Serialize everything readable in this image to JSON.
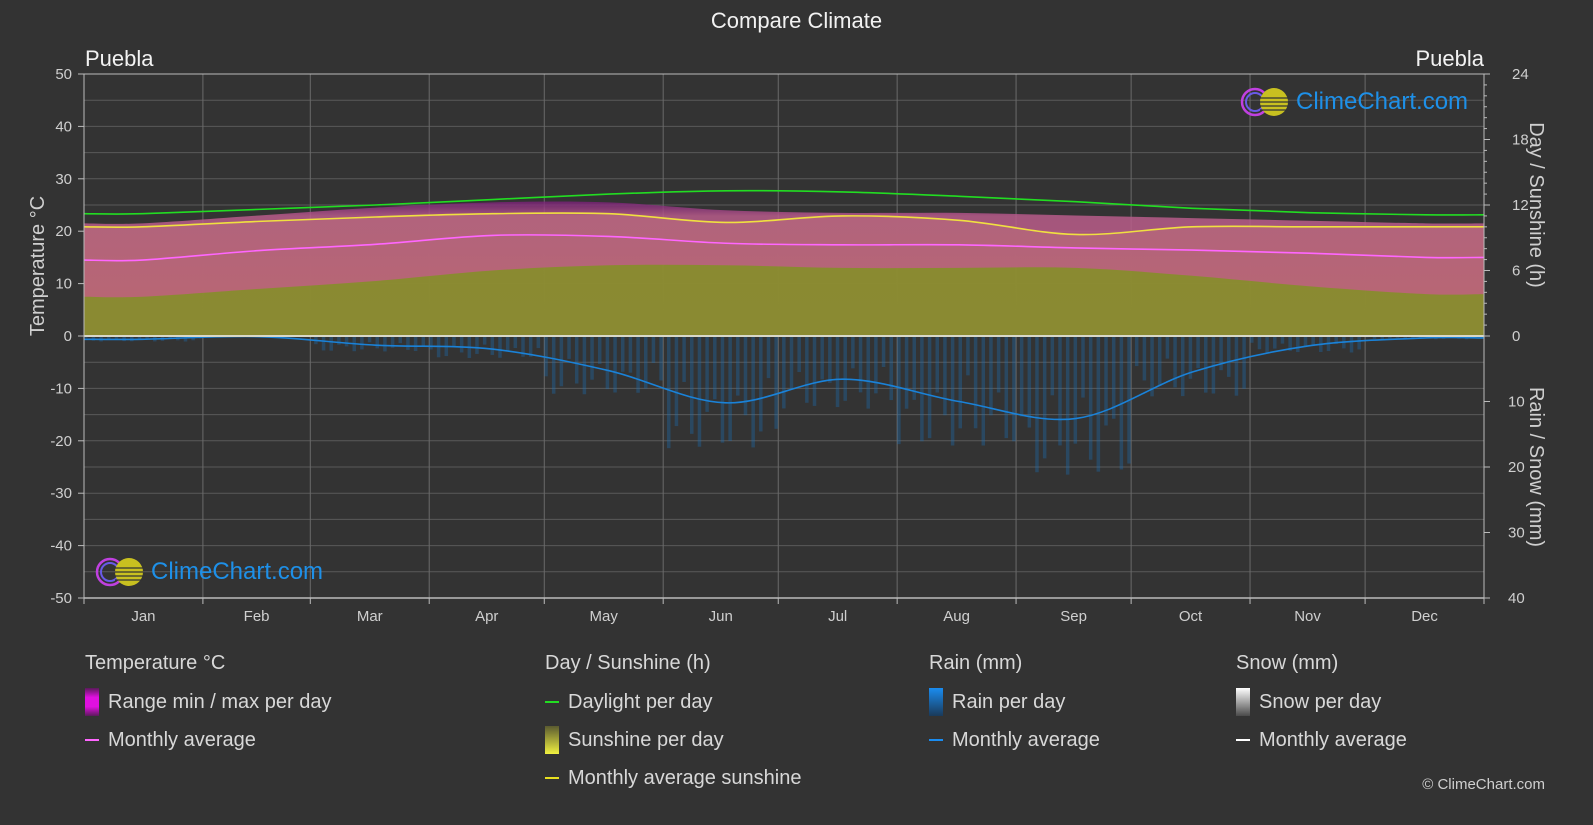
{
  "title": "Compare Climate",
  "city_left": "Puebla",
  "city_right": "Puebla",
  "logo_text": "ClimeChart.com",
  "copyright": "© ClimeChart.com",
  "colors": {
    "background": "#333333",
    "temp_range": "#e13ce1",
    "temp_avg": "#ff66ff",
    "daylight": "#22dd22",
    "sunshine_fill": "#8f8f30",
    "sunshine_avg": "#f0e040",
    "rain": "#1a82d8",
    "snow": "#ffffff",
    "grid": "#5a5a5a"
  },
  "legend": {
    "temperature": {
      "head": "Temperature °C",
      "items": [
        "Range min / max per day",
        "Monthly average"
      ]
    },
    "sunshine": {
      "head": "Day / Sunshine (h)",
      "items": [
        "Daylight per day",
        "Sunshine per day",
        "Monthly average sunshine"
      ]
    },
    "rain": {
      "head": "Rain (mm)",
      "items": [
        "Rain per day",
        "Monthly average"
      ]
    },
    "snow": {
      "head": "Snow (mm)",
      "items": [
        "Snow per day",
        "Monthly average"
      ]
    }
  },
  "chart_data": {
    "type": "line",
    "title": "Compare Climate",
    "categories": [
      "Jan",
      "Feb",
      "Mar",
      "Apr",
      "May",
      "Jun",
      "Jul",
      "Aug",
      "Sep",
      "Oct",
      "Nov",
      "Dec"
    ],
    "left_axis": {
      "label": "Temperature °C",
      "range": [
        -50,
        50
      ],
      "ticks": [
        50,
        40,
        30,
        20,
        10,
        0,
        -10,
        -20,
        -30,
        -40,
        -50
      ]
    },
    "right_axis_top": {
      "label": "Day / Sunshine (h)",
      "range": [
        0,
        24
      ],
      "ticks": [
        24,
        18,
        12,
        6,
        0
      ]
    },
    "right_axis_bottom": {
      "label": "Rain / Snow (mm)",
      "range": [
        0,
        40
      ],
      "ticks": [
        0,
        10,
        20,
        30,
        40
      ]
    },
    "grid": true,
    "series": [
      {
        "name": "Temperature monthly average",
        "unit": "°C",
        "values": [
          14.5,
          16.3,
          17.5,
          19.2,
          19.0,
          17.7,
          17.4,
          17.4,
          16.8,
          16.4,
          15.8,
          15.0
        ]
      },
      {
        "name": "Temperature daily max (approx)",
        "unit": "°C",
        "values": [
          21.5,
          23.0,
          24.5,
          25.5,
          25.5,
          24.0,
          23.5,
          23.5,
          23.0,
          22.5,
          22.0,
          21.5
        ]
      },
      {
        "name": "Temperature daily min (approx)",
        "unit": "°C",
        "values": [
          7.5,
          9.0,
          10.5,
          12.5,
          13.5,
          13.5,
          13.0,
          13.0,
          13.0,
          11.5,
          9.5,
          8.0
        ]
      },
      {
        "name": "Daylight per day",
        "unit": "h",
        "values": [
          11.2,
          11.6,
          12.0,
          12.5,
          13.0,
          13.3,
          13.2,
          12.8,
          12.3,
          11.7,
          11.3,
          11.1
        ]
      },
      {
        "name": "Monthly average sunshine",
        "unit": "h",
        "values": [
          10.0,
          10.5,
          10.9,
          11.2,
          11.2,
          10.4,
          11.0,
          10.6,
          9.3,
          10.0,
          10.0,
          10.0
        ]
      },
      {
        "name": "Rain monthly average",
        "unit": "mm",
        "values": [
          0.5,
          0.1,
          1.4,
          2.0,
          5.3,
          10.2,
          6.6,
          10.0,
          12.6,
          5.5,
          1.5,
          0.3
        ]
      },
      {
        "name": "Snow monthly average",
        "unit": "mm",
        "values": [
          0,
          0,
          0,
          0,
          0,
          0,
          0,
          0,
          0,
          0,
          0,
          0
        ]
      }
    ]
  }
}
